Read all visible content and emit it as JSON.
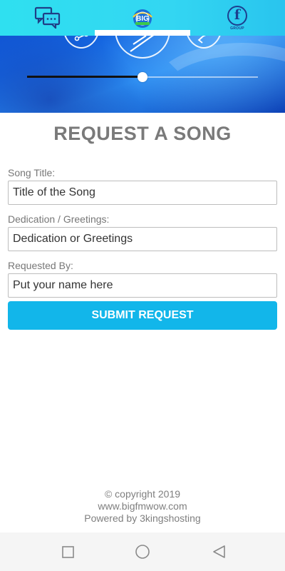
{
  "topbar": {
    "chat_icon": "chat-bubbles-icon",
    "logo_text": "BIG",
    "facebook_letter": "f",
    "facebook_label": "GROUP"
  },
  "player": {
    "progress": 0.5,
    "controls": [
      "share-icon",
      "play-icon",
      "share-back-icon"
    ]
  },
  "form": {
    "title": "REQUEST A SONG",
    "song_title_label": "Song Title:",
    "song_title_placeholder": "Title of the Song",
    "dedication_label": "Dedication / Greetings:",
    "dedication_placeholder": "Dedication or Greetings",
    "requested_by_label": "Requested By:",
    "requested_by_placeholder": "Put your name here",
    "submit_label": "SUBMIT REQUEST"
  },
  "footer": {
    "copyright": "© copyright 2019",
    "website": "www.bigfmwow.com",
    "powered_by": "Powered by 3kingshosting"
  },
  "navbar": {
    "buttons": [
      "recent-apps-icon",
      "home-icon",
      "back-icon"
    ]
  },
  "colors": {
    "accent": "#12b6ea",
    "topbar": "#33d6f2",
    "title_text": "#7a7a7a"
  }
}
